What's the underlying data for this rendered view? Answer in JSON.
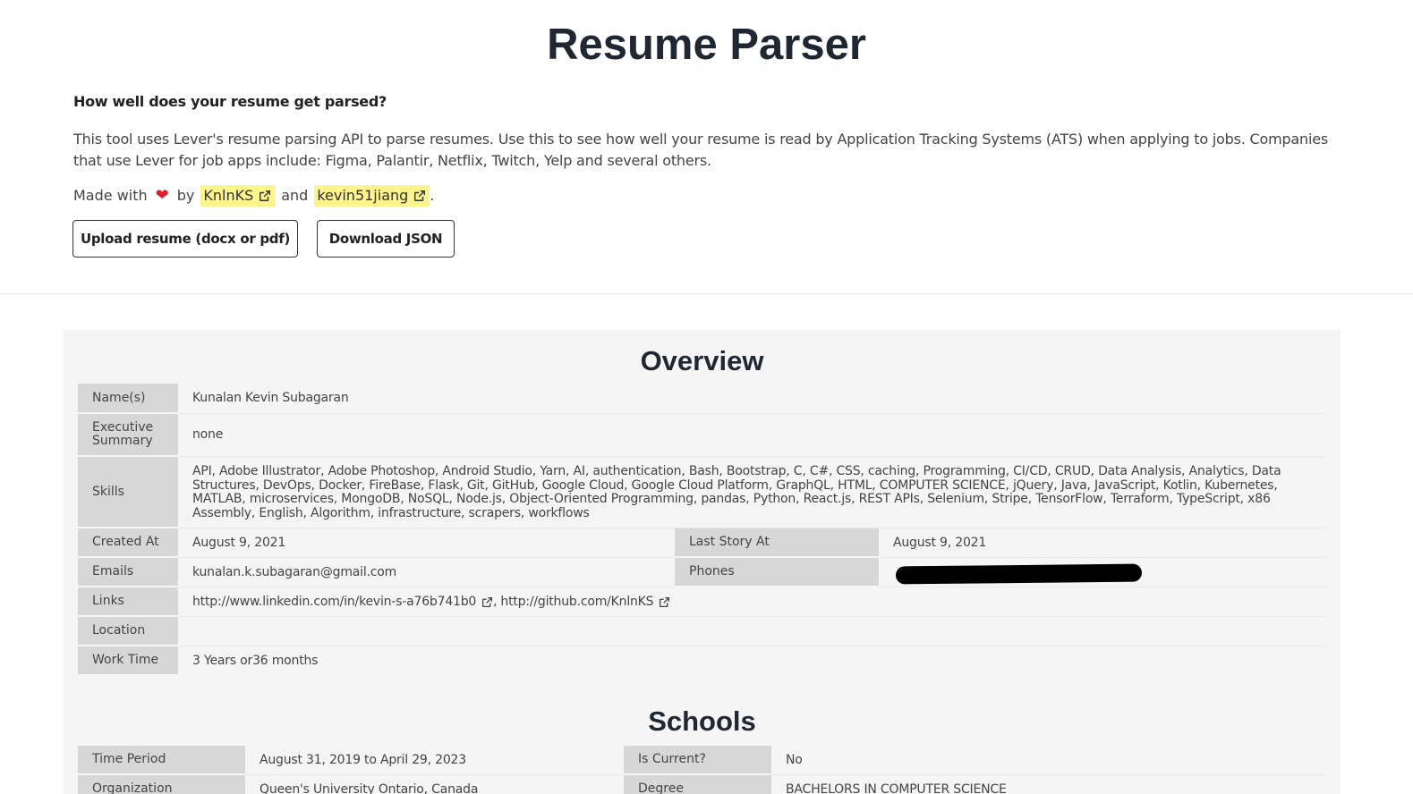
{
  "header": {
    "title": "Resume Parser"
  },
  "intro": {
    "question": "How well does your resume get parsed?",
    "description": "This tool uses Lever's resume parsing API to parse resumes. Use this to see how well your resume is read by Application Tracking Systems (ATS) when applying to jobs. Companies that use Lever for job apps include: Figma, Palantir, Netflix, Twitch, Yelp and several others.",
    "made_with": "Made with",
    "by": "by",
    "and": "and",
    "author1": "KnlnKS",
    "author2": "kevin51jiang",
    "period": "."
  },
  "actions": {
    "upload_label": "Upload resume (docx or pdf)",
    "download_label": "Download JSON"
  },
  "overview": {
    "title": "Overview",
    "name_label": "Name(s)",
    "name_value": "Kunalan Kevin Subagaran",
    "summary_label": "Executive Summary",
    "summary_value": "none",
    "skills_label": "Skills",
    "skills_value": "API, Adobe Illustrator, Adobe Photoshop, Android Studio, Yarn, AI, authentication, Bash, Bootstrap, C, C#, CSS, caching, Programming, CI/CD, CRUD, Data Analysis, Analytics, Data Structures, DevOps, Docker, FireBase, Flask, Git, GitHub, Google Cloud, Google Cloud Platform, GraphQL, HTML, COMPUTER SCIENCE, jQuery, Java, JavaScript, Kotlin, Kubernetes, MATLAB, microservices, MongoDB, NoSQL, Node.js, Object-Oriented Programming, pandas, Python, React.js, REST APIs, Selenium, Stripe, TensorFlow, Terraform, TypeScript, x86 Assembly, English, Algorithm, infrastructure, scrapers, workflows",
    "created_label": "Created At",
    "created_value": "August 9, 2021",
    "last_story_label": "Last Story At",
    "last_story_value": "August 9, 2021",
    "emails_label": "Emails",
    "emails_value": "kunalan.k.subagaran@gmail.com",
    "phones_label": "Phones",
    "links_label": "Links",
    "link1": "http://www.linkedin.com/in/kevin-s-a76b741b0",
    "link_sep": ",",
    "link2": "http://github.com/KnlnKS",
    "location_label": "Location",
    "location_value": "",
    "worktime_label": "Work Time",
    "worktime_value": "3 Years or36 months"
  },
  "schools": {
    "title": "Schools",
    "period_label": "Time Period",
    "period_value": "August 31, 2019 to April 29, 2023",
    "current_label": "Is Current?",
    "current_value": "No",
    "org_label": "Organization",
    "org_value": "Queen's University Ontario, Canada",
    "degree_label": "Degree",
    "degree_value": "BACHELORS IN COMPUTER SCIENCE"
  },
  "colors": {
    "highlight": "#fdf48a",
    "heart": "#e11d2a",
    "label_bg": "#d7d7d7",
    "panel_bg": "#f5f5f5",
    "title": "#1f2733"
  },
  "icons": [
    "heart-icon",
    "external-link-icon"
  ]
}
